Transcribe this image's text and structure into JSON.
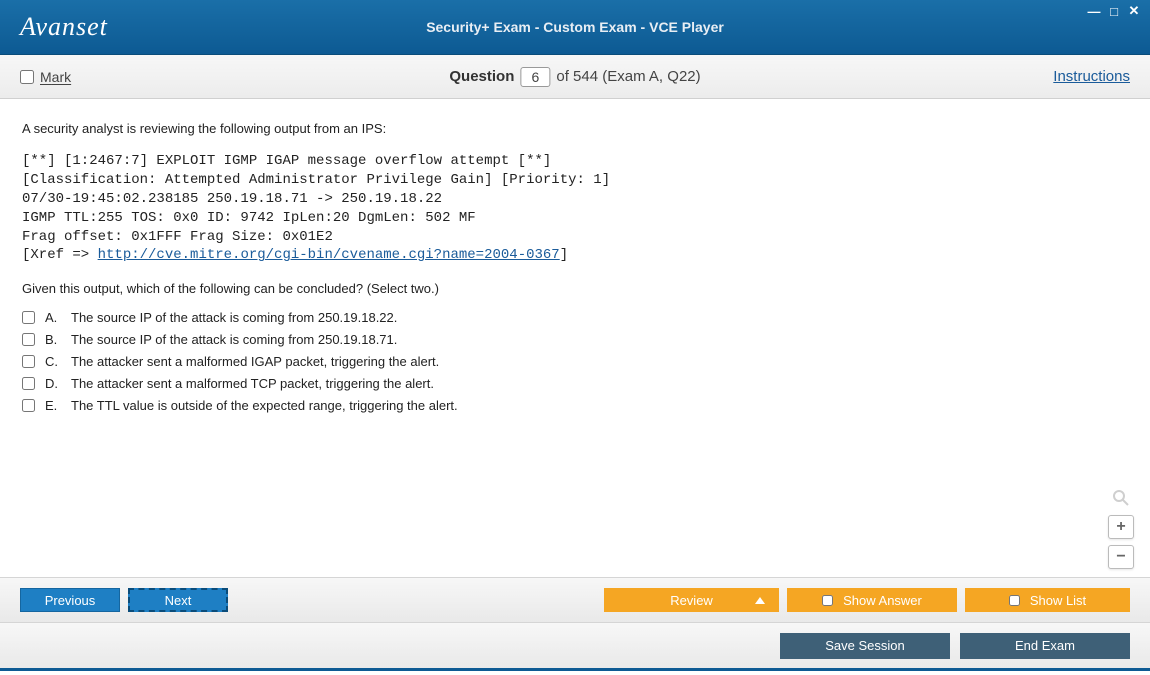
{
  "header": {
    "logo_text": "Avanset",
    "title": "Security+ Exam - Custom Exam - VCE Player"
  },
  "infobar": {
    "mark_label": "Mark",
    "question_label": "Question",
    "question_number": "6",
    "question_total": "of 544 (Exam A, Q22)",
    "instructions_label": "Instructions"
  },
  "question": {
    "intro": "A security analyst is reviewing the following output from an IPS:",
    "code_lines": [
      "[**] [1:2467:7] EXPLOIT IGMP IGAP message overflow attempt [**]",
      "[Classification: Attempted Administrator Privilege Gain] [Priority: 1]",
      "07/30-19:45:02.238185 250.19.18.71 -> 250.19.18.22",
      "IGMP TTL:255 TOS: 0x0 ID: 9742 IpLen:20 DgmLen: 502 MF",
      "Frag offset: 0x1FFF Frag Size: 0x01E2"
    ],
    "xref_prefix": "[Xref => ",
    "xref_link": "http://cve.mitre.org/cgi-bin/cvename.cgi?name=2004-0367",
    "xref_suffix": "]",
    "prompt": "Given this output, which of the following can be concluded? (Select two.)",
    "options": [
      {
        "letter": "A.",
        "text": "The source IP of the attack is coming from 250.19.18.22."
      },
      {
        "letter": "B.",
        "text": "The source IP of the attack is coming from 250.19.18.71."
      },
      {
        "letter": "C.",
        "text": "The attacker sent a malformed IGAP packet, triggering the alert."
      },
      {
        "letter": "D.",
        "text": "The attacker sent a malformed TCP packet, triggering the alert."
      },
      {
        "letter": "E.",
        "text": "The TTL value is outside of the expected range, triggering the alert."
      }
    ]
  },
  "footer": {
    "previous": "Previous",
    "next": "Next",
    "review": "Review",
    "show_answer": "Show Answer",
    "show_list": "Show List",
    "save_session": "Save Session",
    "end_exam": "End Exam"
  }
}
